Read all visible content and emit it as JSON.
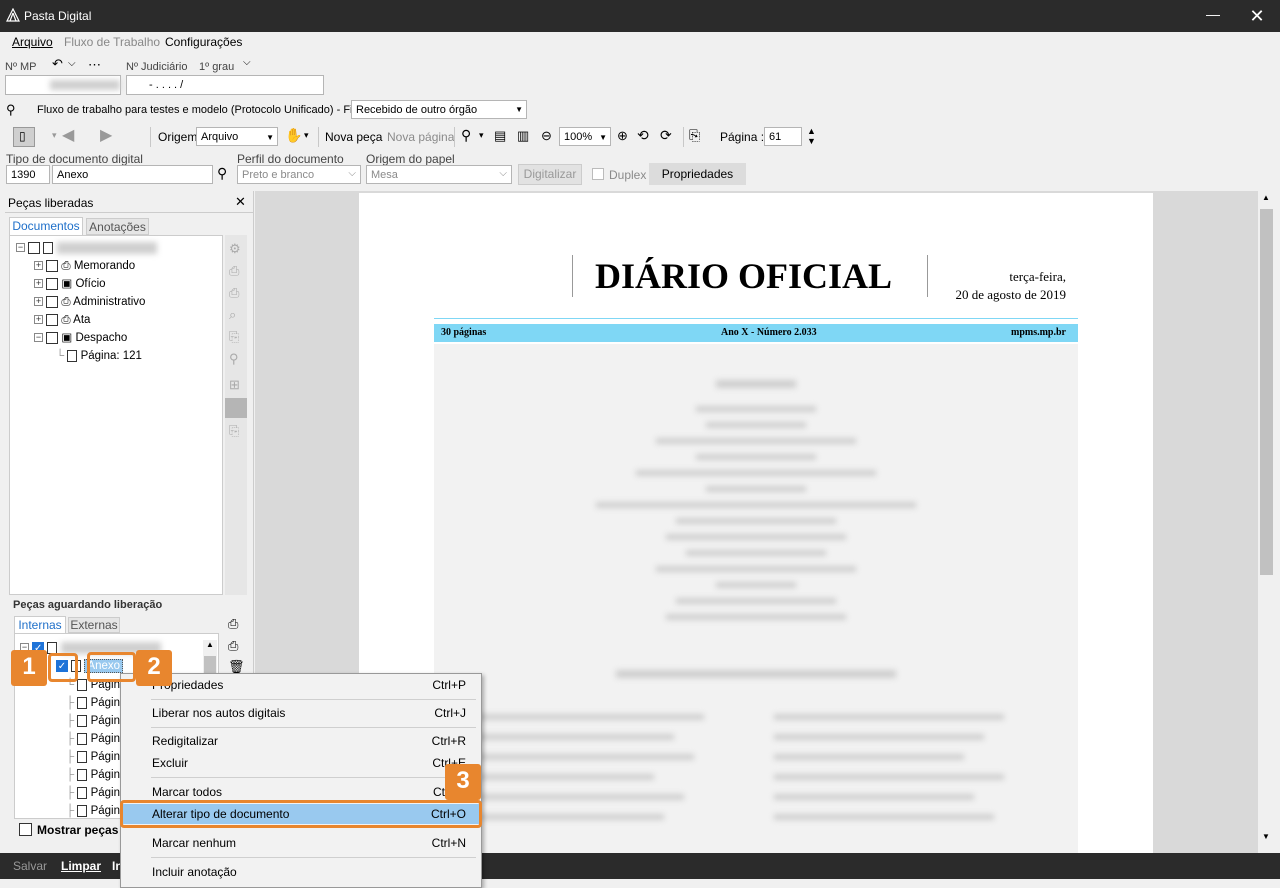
{
  "app": {
    "title": "Pasta Digital"
  },
  "menu": {
    "arquivo": "Arquivo",
    "fluxo": "Fluxo de Trabalho",
    "config": "Configurações"
  },
  "header": {
    "mp_label": "Nº MP",
    "judiciario_label": "Nº Judiciário",
    "grau": "1º grau",
    "judiciario_value": "- . . . . /"
  },
  "workflow": {
    "label": "Fluxo de trabalho para testes e modelo (Protocolo Unificado) - Fila",
    "fila_value": "Recebido de outro órgão"
  },
  "toolbar": {
    "origem_label": "Origem",
    "origem_value": "Arquivo",
    "nova_peca": "Nova peça",
    "nova_pagina": "Nova página",
    "zoom": "100%",
    "pagina_label": "Página :",
    "pagina_value": "61"
  },
  "docfields": {
    "tipo_label": "Tipo de documento digital",
    "tipo_code": "1390",
    "tipo_name": "Anexo",
    "perfil_label": "Perfil do documento",
    "perfil_value": "Preto e branco",
    "origem_papel_label": "Origem do papel",
    "origem_papel_value": "Mesa",
    "digitalizar": "Digitalizar",
    "duplex": "Duplex",
    "propriedades": "Propriedades"
  },
  "left": {
    "liberadas_title": "Peças liberadas",
    "tab_documentos": "Documentos",
    "tab_anotacoes": "Anotações",
    "tree": [
      "Memorando",
      "Ofício",
      "Administrativo",
      "Ata",
      "Despacho"
    ],
    "pagina_item": "Página: 121",
    "aguardando_title": "Peças aguardando liberação",
    "tab_internas": "Internas",
    "tab_externas": "Externas",
    "anexo": "Anexo",
    "pag_short": "Págin",
    "mostrar": "Mostrar peças se"
  },
  "document": {
    "title": "DIÁRIO OFICIAL",
    "date_line1": "terça-feira,",
    "date_line2": "20 de agosto de 2019",
    "band_left": "30 páginas",
    "band_center": "Ano X - Número 2.033",
    "band_right": "mpms.mp.br"
  },
  "context_menu": {
    "items": [
      {
        "label": "Propriedades",
        "shortcut": "Ctrl+P"
      },
      {
        "label": "Liberar nos autos digitais",
        "shortcut": "Ctrl+J"
      },
      {
        "label": "Redigitalizar",
        "shortcut": "Ctrl+R"
      },
      {
        "label": "Excluir",
        "shortcut": "Ctrl+E"
      },
      {
        "label": "Marcar todos",
        "shortcut": "Ctrl+T"
      },
      {
        "label": "Alterar tipo de documento",
        "shortcut": "Ctrl+O"
      },
      {
        "label": "Marcar nenhum",
        "shortcut": "Ctrl+N"
      },
      {
        "label": "Incluir anotação",
        "shortcut": ""
      }
    ]
  },
  "footer": {
    "salvar": "Salvar",
    "limpar": "Limpar",
    "in": "In"
  },
  "badges": {
    "one": "1",
    "two": "2",
    "three": "3"
  },
  "colors": {
    "accent": "#e8862e",
    "band": "#7fd7f5",
    "select": "#99c9ef"
  }
}
